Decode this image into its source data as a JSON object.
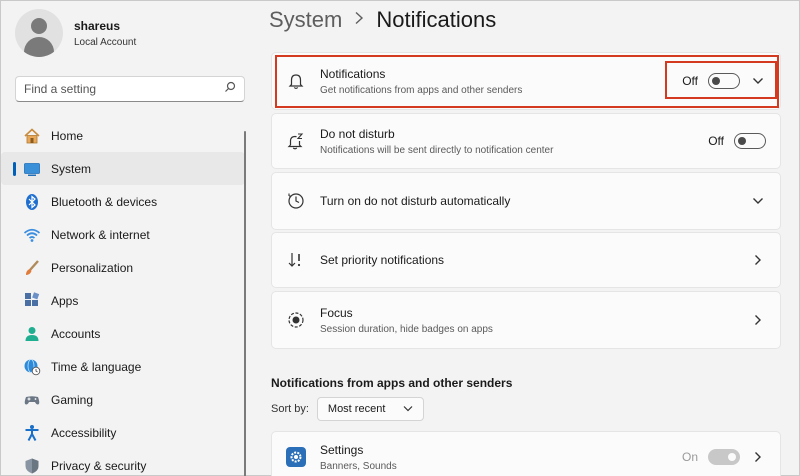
{
  "user": {
    "name": "shareus",
    "account_type": "Local Account"
  },
  "search": {
    "placeholder": "Find a setting"
  },
  "nav": [
    {
      "label": "Home",
      "icon": "home-icon",
      "active": false
    },
    {
      "label": "System",
      "icon": "monitor-icon",
      "active": true
    },
    {
      "label": "Bluetooth & devices",
      "icon": "bluetooth-icon",
      "active": false
    },
    {
      "label": "Network & internet",
      "icon": "wifi-icon",
      "active": false
    },
    {
      "label": "Personalization",
      "icon": "brush-icon",
      "active": false
    },
    {
      "label": "Apps",
      "icon": "apps-icon",
      "active": false
    },
    {
      "label": "Accounts",
      "icon": "person-icon",
      "active": false
    },
    {
      "label": "Time & language",
      "icon": "globe-clock-icon",
      "active": false
    },
    {
      "label": "Gaming",
      "icon": "gamepad-icon",
      "active": false
    },
    {
      "label": "Accessibility",
      "icon": "accessibility-icon",
      "active": false
    },
    {
      "label": "Privacy & security",
      "icon": "shield-icon",
      "active": false
    }
  ],
  "breadcrumb": {
    "parent": "System",
    "current": "Notifications"
  },
  "cards": {
    "notifications": {
      "title": "Notifications",
      "desc": "Get notifications from apps and other senders",
      "state": "Off"
    },
    "dnd": {
      "title": "Do not disturb",
      "desc": "Notifications will be sent directly to notification center",
      "state": "Off"
    },
    "dnd_auto": {
      "title": "Turn on do not disturb automatically"
    },
    "priority": {
      "title": "Set priority notifications"
    },
    "focus": {
      "title": "Focus",
      "desc": "Session duration, hide badges on apps"
    }
  },
  "apps_section": {
    "title": "Notifications from apps and other senders",
    "sort_label": "Sort by:",
    "sort_value": "Most recent",
    "apps": [
      {
        "name": "Settings",
        "desc": "Banners, Sounds",
        "state": "On"
      }
    ]
  },
  "colors": {
    "accent": "#005fb8",
    "highlight": "#d33a1f"
  }
}
